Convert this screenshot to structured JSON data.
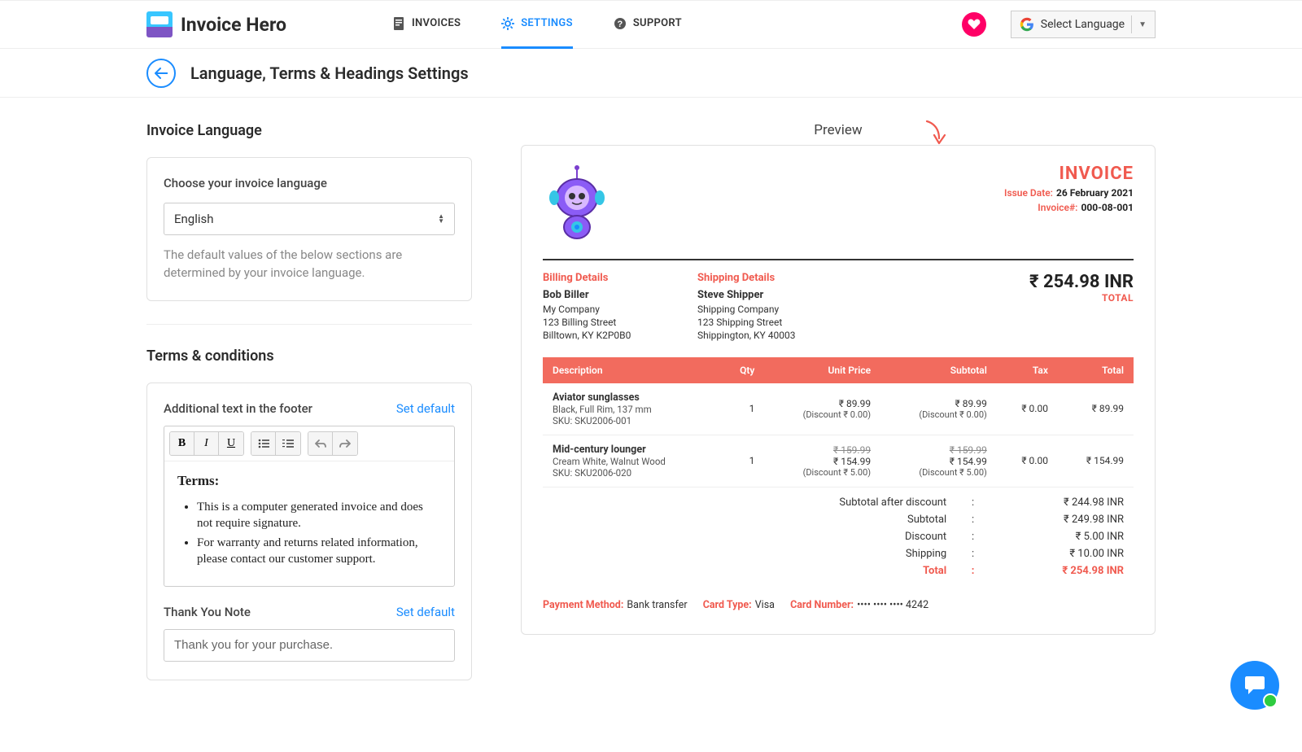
{
  "header": {
    "app_title": "Invoice Hero",
    "nav": {
      "invoices": "INVOICES",
      "settings": "SETTINGS",
      "support": "SUPPORT"
    },
    "lang_select": "Select Language"
  },
  "subhead": {
    "title": "Language, Terms & Headings Settings"
  },
  "left": {
    "language": {
      "section": "Invoice Language",
      "label": "Choose your invoice language",
      "value": "English",
      "help": "The default values of the below sections are determined by your invoice language."
    },
    "terms": {
      "section": "Terms & conditions",
      "footer_label": "Additional text in the footer",
      "set_default": "Set default",
      "terms_heading": "Terms:",
      "bullets": [
        "This is a computer generated invoice and does not require signature.",
        "For warranty and returns related information, please contact our customer support."
      ],
      "thank_label": "Thank You Note",
      "thank_value": "Thank you for your purchase."
    }
  },
  "preview": {
    "label": "Preview",
    "title": "INVOICE",
    "issue_date_k": "Issue Date:",
    "issue_date_v": "26 February 2021",
    "invoice_no_k": "Invoice#:",
    "invoice_no_v": "000-08-001",
    "billing": {
      "h": "Billing Details",
      "name": "Bob Biller",
      "l1": "My Company",
      "l2": "123 Billing Street",
      "l3": "Billtown, KY K2P0B0"
    },
    "shipping": {
      "h": "Shipping Details",
      "name": "Steve Shipper",
      "l1": "Shipping Company",
      "l2": "123 Shipping Street",
      "l3": "Shippington, KY 40003"
    },
    "grand_total": "₹ 254.98 INR",
    "grand_total_lbl": "TOTAL",
    "cols": {
      "desc": "Description",
      "qty": "Qty",
      "unit": "Unit Price",
      "sub": "Subtotal",
      "tax": "Tax",
      "total": "Total"
    },
    "items": [
      {
        "name": "Aviator sunglasses",
        "sub": "Black, Full Rim, 137 mm",
        "sku": "SKU: SKU2006-001",
        "qty": "1",
        "unit_strike": "",
        "unit": "₹ 89.99",
        "unit_disc": "(Discount ₹ 0.00)",
        "subtotal_strike": "",
        "subtotal": "₹ 89.99",
        "subtotal_disc": "(Discount ₹ 0.00)",
        "tax": "₹ 0.00",
        "total": "₹ 89.99"
      },
      {
        "name": "Mid-century lounger",
        "sub": "Cream White, Walnut Wood",
        "sku": "SKU: SKU2006-020",
        "qty": "1",
        "unit_strike": "₹ 159.99",
        "unit": "₹ 154.99",
        "unit_disc": "(Discount ₹ 5.00)",
        "subtotal_strike": "₹ 159.99",
        "subtotal": "₹ 154.99",
        "subtotal_disc": "(Discount ₹ 5.00)",
        "tax": "₹ 0.00",
        "total": "₹ 154.99"
      }
    ],
    "summary": [
      {
        "k": "Subtotal after discount",
        "v": "₹ 244.98 INR"
      },
      {
        "k": "Subtotal",
        "v": "₹ 249.98 INR"
      },
      {
        "k": "Discount",
        "v": "₹ 5.00 INR"
      },
      {
        "k": "Shipping",
        "v": "₹ 10.00 INR"
      }
    ],
    "summary_total": {
      "k": "Total",
      "v": "₹ 254.98 INR"
    },
    "pay": {
      "method_k": "Payment Method:",
      "method_v": "Bank transfer",
      "card_type_k": "Card Type:",
      "card_type_v": "Visa",
      "card_num_k": "Card Number:",
      "card_num_v": "•••• •••• •••• 4242"
    }
  }
}
